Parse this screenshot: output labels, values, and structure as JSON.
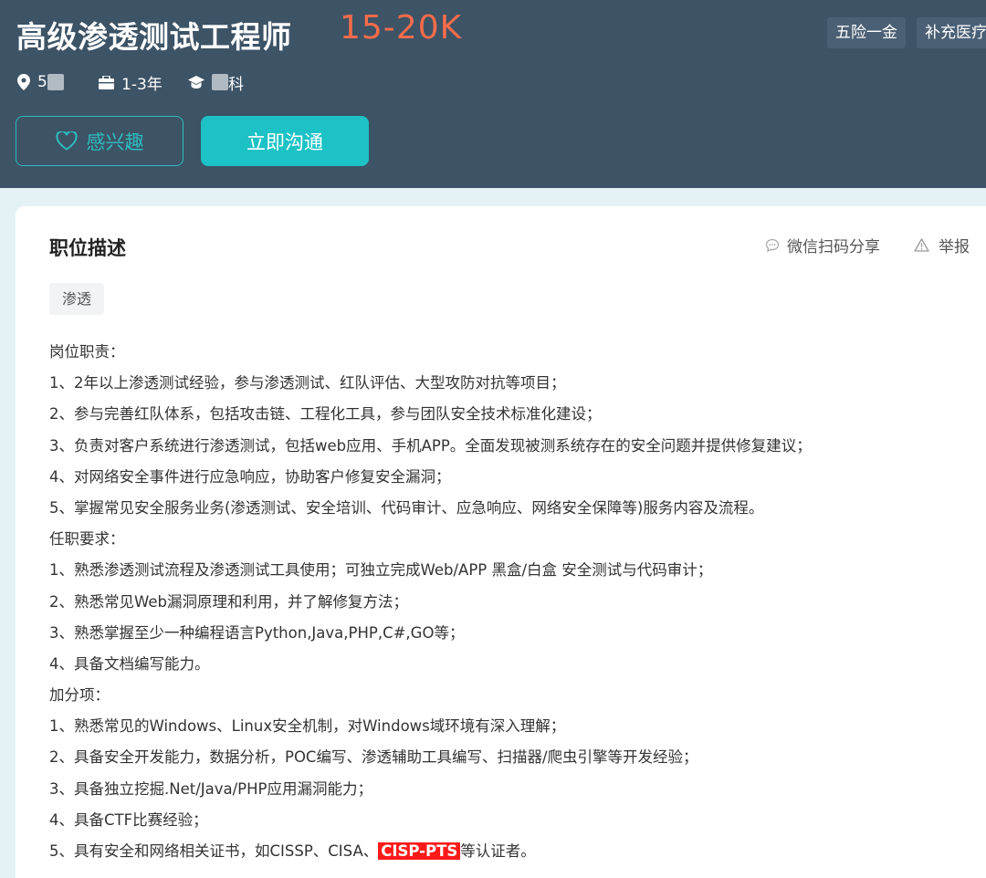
{
  "header": {
    "job_title": "高级渗透测试工程师",
    "salary": "15-20K",
    "benefits": [
      "五险一金",
      "补充医疗"
    ],
    "location_visible": "5",
    "experience": "1-3年",
    "education_visible": "科",
    "interest_label": "感兴趣",
    "chat_label": "立即沟通"
  },
  "card": {
    "title": "职位描述",
    "share_label": "微信扫码分享",
    "report_label": "举报",
    "skill_tag": "渗透",
    "lines": [
      "岗位职责：",
      "1、2年以上渗透测试经验，参与渗透测试、红队评估、大型攻防对抗等项目；",
      "2、参与完善红队体系，包括攻击链、工程化工具，参与团队安全技术标准化建设；",
      "3、负责对客户系统进行渗透测试，包括web应用、手机APP。全面发现被测系统存在的安全问题并提供修复建议；",
      "4、对网络安全事件进行应急响应，协助客户修复安全漏洞；",
      "5、掌握常见安全服务业务(渗透测试、安全培训、代码审计、应急响应、网络安全保障等)服务内容及流程。",
      "任职要求：",
      "1、熟悉渗透测试流程及渗透测试工具使用；可独立完成Web/APP 黑盒/白盒 安全测试与代码审计；",
      "2、熟悉常见Web漏洞原理和利用，并了解修复方法；",
      "3、熟悉掌握至少一种编程语言Python,Java,PHP,C#,GO等；",
      "4、具备文档编写能力。",
      "加分项：",
      "1、熟悉常见的Windows、Linux安全机制，对Windows域环境有深入理解；",
      "2、具备安全开发能力，数据分析，POC编写、渗透辅助工具编写、扫描器/爬虫引擎等开发经验；",
      "3、具备独立挖掘.Net/Java/PHP应用漏洞能力；",
      "4、具备CTF比赛经验；"
    ],
    "last_line": {
      "before": "5、具有安全和网络相关证书，如CISSP、CISA、",
      "highlight": "CISP-PTS",
      "after": "等认证者。"
    }
  },
  "colors": {
    "header_bg": "#3d5366",
    "salary": "#f66c4b",
    "accent": "#1cc2c5",
    "highlight": "#ff1a1a"
  },
  "icons": [
    "location-pin-icon",
    "briefcase-icon",
    "graduation-cap-icon",
    "heart-icon",
    "chat-bubble-icon",
    "warning-icon"
  ]
}
